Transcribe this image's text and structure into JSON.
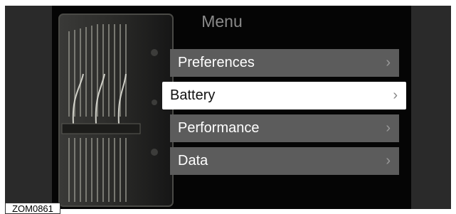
{
  "menu": {
    "title": "Menu",
    "items": [
      {
        "label": "Preferences",
        "selected": false
      },
      {
        "label": "Battery",
        "selected": true
      },
      {
        "label": "Performance",
        "selected": false
      },
      {
        "label": "Data",
        "selected": false
      }
    ],
    "chevron": "›"
  },
  "figure_code": "ZOM0861",
  "colors": {
    "background": "#000000",
    "menu_item": "#5c5c5c",
    "menu_item_selected": "#ffffff",
    "title": "#8a8a8a"
  },
  "icons": {
    "background_image": "battery-pack-image",
    "chevron": "chevron-right-icon"
  }
}
